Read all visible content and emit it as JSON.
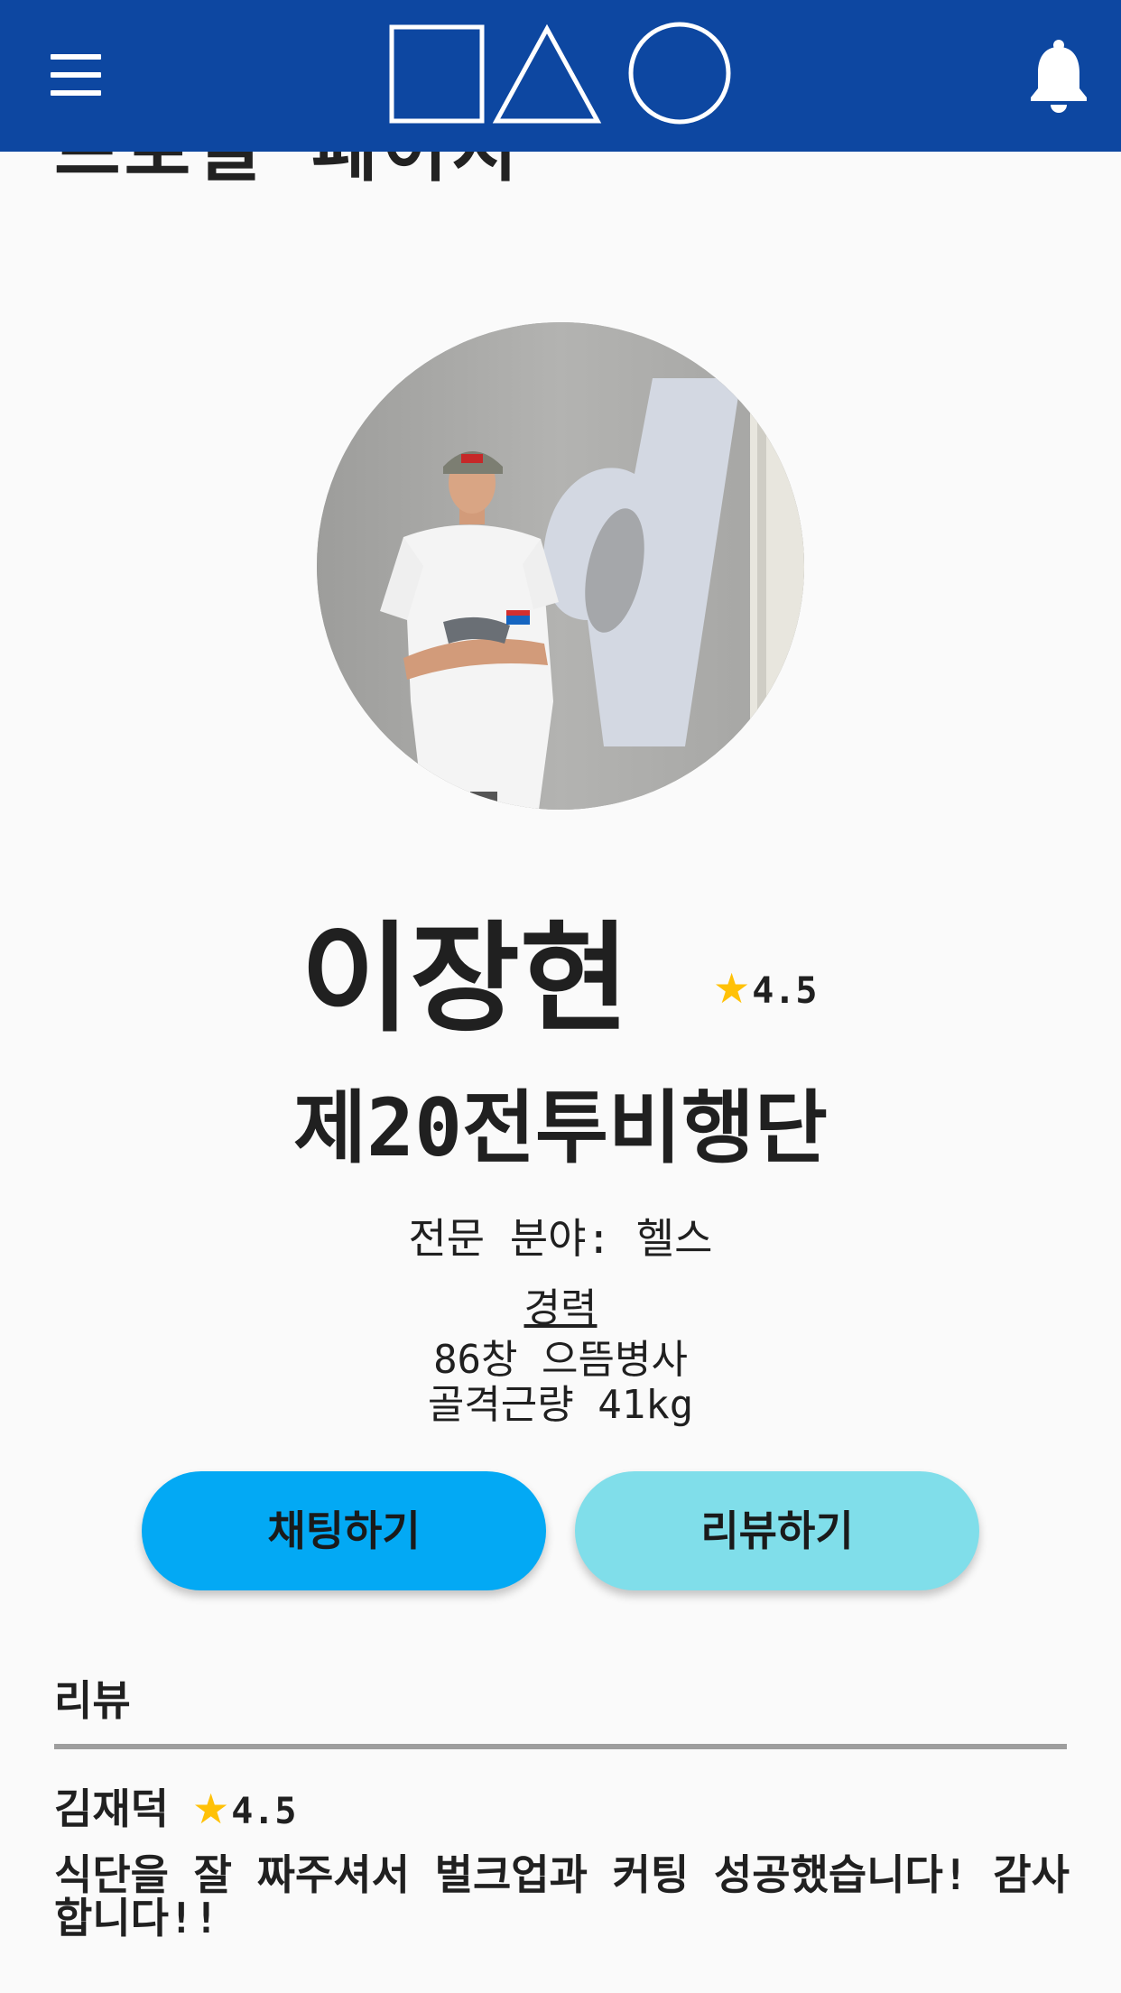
{
  "header": {
    "menu_icon": "hamburger-menu-icon",
    "logo_shapes": [
      "square",
      "triangle",
      "circle"
    ],
    "notification_icon": "bell-icon",
    "background": "#0d47a1"
  },
  "page": {
    "title": "프로필 페이지"
  },
  "profile": {
    "photo_alt": "이장현 프로필 사진",
    "name": "이장현",
    "rating": "4.5",
    "unit": "제20전투비행단",
    "specialty": "전문 분야: 헬스",
    "career_title": "경력",
    "career_lines": [
      "86창 으뜸병사",
      "골격근량 41kg"
    ]
  },
  "actions": {
    "chat_label": "채팅하기",
    "review_label": "리뷰하기",
    "chat_color": "#03a9f4",
    "review_color": "#80deea"
  },
  "reviews": {
    "header": "리뷰",
    "items": [
      {
        "author": "김재덕",
        "rating": "4.5",
        "text": "식단을 잘 짜주셔서 벌크업과 커팅 성공했습니다! 감사합니다!!"
      }
    ]
  },
  "colors": {
    "star": "#ffc107",
    "text": "#202020"
  }
}
